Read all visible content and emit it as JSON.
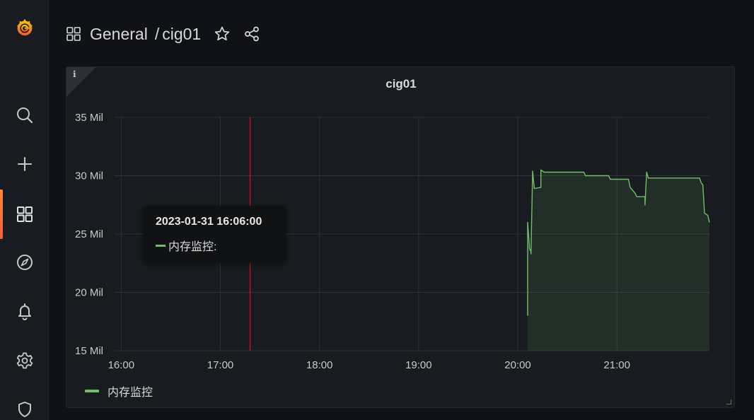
{
  "breadcrumb": {
    "folder": "General",
    "separator": "/",
    "dashboard": "cig01"
  },
  "sidebar": {
    "items": [
      {
        "icon": "grafana-logo-icon"
      },
      {
        "icon": "search-icon"
      },
      {
        "icon": "plus-icon"
      },
      {
        "icon": "dashboards-icon",
        "active": true
      },
      {
        "icon": "explore-compass-icon"
      },
      {
        "icon": "alerting-bell-icon"
      },
      {
        "icon": "configuration-gear-icon"
      },
      {
        "icon": "server-admin-shield-icon"
      }
    ]
  },
  "panel": {
    "title": "cig01",
    "info_icon": "i"
  },
  "tooltip": {
    "time": "2023-01-31 16:06:00",
    "series_label": "内存监控:"
  },
  "legend": {
    "label": "内存监控"
  },
  "colors": {
    "series": "#73bf69",
    "annotation": "#c4162a",
    "background": "#111217",
    "panel": "#181b1f"
  },
  "chart_data": {
    "type": "area",
    "x_unit": "time (HH:MM)",
    "xlim": [
      "15:56",
      "21:56"
    ],
    "x_ticks": [
      "16:00",
      "17:00",
      "18:00",
      "19:00",
      "20:00",
      "21:00"
    ],
    "ylim": [
      15,
      35
    ],
    "y_ticks": [
      {
        "value": 35,
        "label": "35 Mil"
      },
      {
        "value": 30,
        "label": "30 Mil"
      },
      {
        "value": 25,
        "label": "25 Mil"
      },
      {
        "value": 20,
        "label": "20 Mil"
      },
      {
        "value": 15,
        "label": "15 Mil"
      }
    ],
    "grid": true,
    "legend_position": "bottom-left",
    "annotation_time": "17:18",
    "series": [
      {
        "name": "内存监控",
        "points": [
          [
            "20:06",
            18.0
          ],
          [
            "20:06",
            26.0
          ],
          [
            "20:07",
            24.0
          ],
          [
            "20:07",
            23.8
          ],
          [
            "20:08",
            23.5
          ],
          [
            "20:08",
            23.3
          ],
          [
            "20:09",
            30.4
          ],
          [
            "20:10",
            28.9
          ],
          [
            "20:14",
            29.0
          ],
          [
            "20:14",
            30.5
          ],
          [
            "20:16",
            30.3
          ],
          [
            "20:40",
            30.3
          ],
          [
            "20:41",
            30.0
          ],
          [
            "20:55",
            30.0
          ],
          [
            "20:56",
            29.7
          ],
          [
            "21:07",
            29.7
          ],
          [
            "21:08",
            29.0
          ],
          [
            "21:11",
            28.5
          ],
          [
            "21:12",
            28.2
          ],
          [
            "21:17",
            28.2
          ],
          [
            "21:17",
            27.5
          ],
          [
            "21:18",
            30.3
          ],
          [
            "21:19",
            29.8
          ],
          [
            "21:50",
            29.8
          ],
          [
            "21:51",
            29.4
          ],
          [
            "21:52",
            29.2
          ],
          [
            "21:53",
            26.8
          ],
          [
            "21:55",
            26.6
          ],
          [
            "21:56",
            26.0
          ]
        ]
      }
    ]
  }
}
